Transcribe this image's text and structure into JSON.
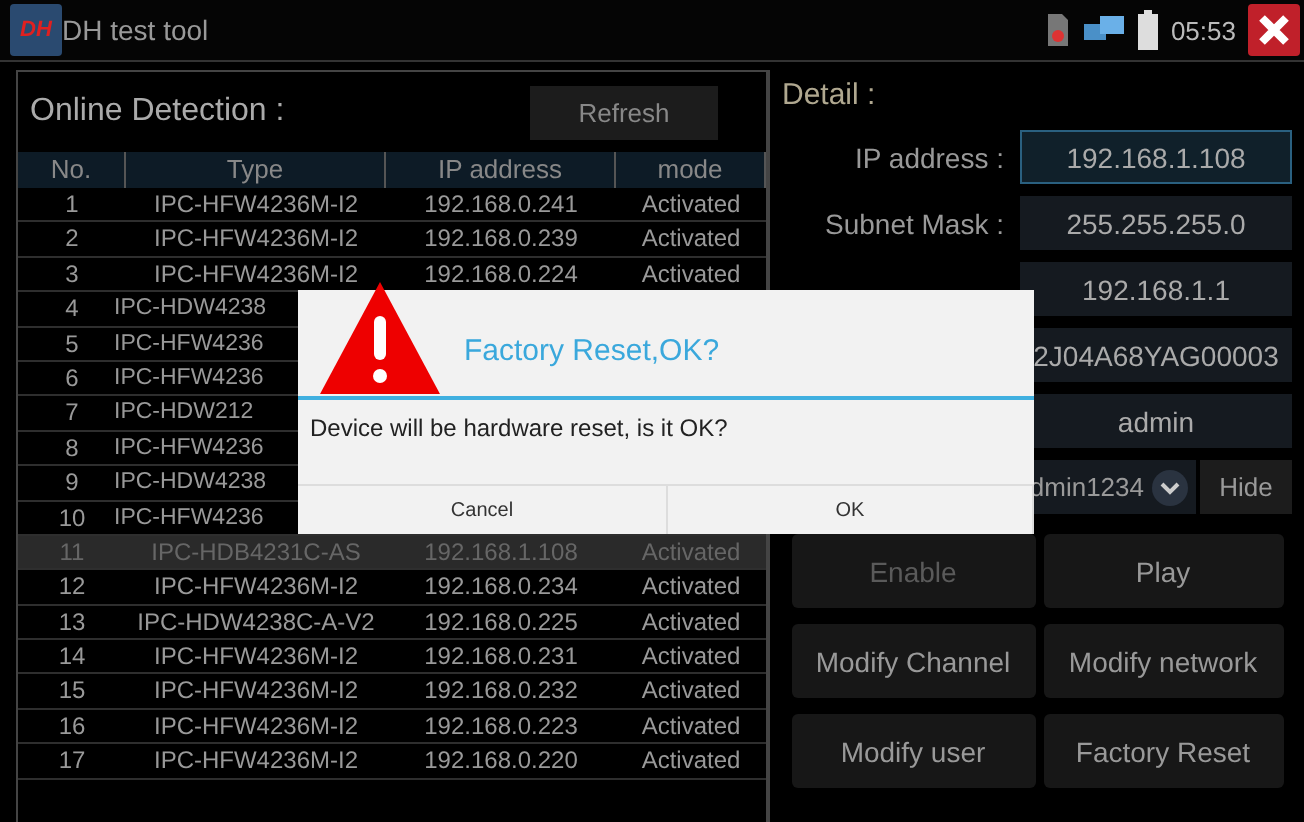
{
  "title_bar": {
    "logo": "DH",
    "title": "DH test tool",
    "time": "05:53"
  },
  "online_detection": {
    "title": "Online Detection :",
    "refresh_button": "Refresh",
    "columns": [
      "No.",
      "Type",
      "IP address",
      "mode"
    ],
    "rows": [
      {
        "no": "1",
        "type": "IPC-HFW4236M-I2",
        "ip": "192.168.0.241",
        "mode": "Activated",
        "selected": false
      },
      {
        "no": "2",
        "type": "IPC-HFW4236M-I2",
        "ip": "192.168.0.239",
        "mode": "Activated",
        "selected": false
      },
      {
        "no": "3",
        "type": "IPC-HFW4236M-I2",
        "ip": "192.168.0.224",
        "mode": "Activated",
        "selected": false
      },
      {
        "no": "4",
        "type": "IPC-HDW4238",
        "selected": false
      },
      {
        "no": "5",
        "type": "IPC-HFW4236",
        "selected": false
      },
      {
        "no": "6",
        "type": "IPC-HFW4236",
        "selected": false
      },
      {
        "no": "7",
        "type": "IPC-HDW212",
        "selected": false
      },
      {
        "no": "8",
        "type": "IPC-HFW4236",
        "selected": false
      },
      {
        "no": "9",
        "type": "IPC-HDW4238",
        "selected": false
      },
      {
        "no": "10",
        "type": "IPC-HFW4236",
        "selected": false
      },
      {
        "no": "11",
        "type": "IPC-HDB4231C-AS",
        "ip": "192.168.1.108",
        "mode": "Activated",
        "selected": true
      },
      {
        "no": "12",
        "type": "IPC-HFW4236M-I2",
        "ip": "192.168.0.234",
        "mode": "Activated",
        "selected": false
      },
      {
        "no": "13",
        "type": "IPC-HDW4238C-A-V2",
        "ip": "192.168.0.225",
        "mode": "Activated",
        "selected": false
      },
      {
        "no": "14",
        "type": "IPC-HFW4236M-I2",
        "ip": "192.168.0.231",
        "mode": "Activated",
        "selected": false
      },
      {
        "no": "15",
        "type": "IPC-HFW4236M-I2",
        "ip": "192.168.0.232",
        "mode": "Activated",
        "selected": false
      },
      {
        "no": "16",
        "type": "IPC-HFW4236M-I2",
        "ip": "192.168.0.223",
        "mode": "Activated",
        "selected": false
      },
      {
        "no": "17",
        "type": "IPC-HFW4236M-I2",
        "ip": "192.168.0.220",
        "mode": "Activated",
        "selected": false
      }
    ]
  },
  "detail": {
    "title": "Detail :",
    "fields": [
      {
        "label": "IP address :",
        "value": "192.168.1.108",
        "focused": true
      },
      {
        "label": "Subnet Mask :",
        "value": "255.255.255.0",
        "focused": false
      },
      {
        "value": "192.168.1.1",
        "focused": false
      },
      {
        "value": "2J04A68YAG00003",
        "focused": false
      },
      {
        "value": "admin",
        "focused": false
      }
    ],
    "password": {
      "value": "dmin1234",
      "hide_button": "Hide"
    },
    "buttons": [
      {
        "label": "Enable",
        "disabled": true
      },
      {
        "label": "Play",
        "disabled": false
      },
      {
        "label": "Modify Channel",
        "disabled": false
      },
      {
        "label": "Modify network",
        "disabled": false
      },
      {
        "label": "Modify user",
        "disabled": false
      },
      {
        "label": "Factory Reset",
        "disabled": false
      }
    ]
  },
  "dialog": {
    "title": "Factory Reset,OK?",
    "message": "Device will be hardware reset, is it OK?",
    "buttons": [
      "Cancel",
      "OK"
    ]
  }
}
